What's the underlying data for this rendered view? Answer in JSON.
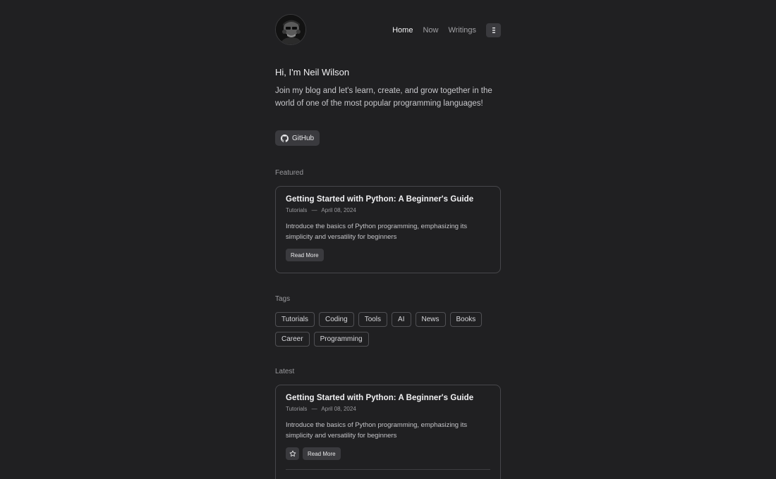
{
  "nav": {
    "items": [
      {
        "label": "Home",
        "active": true
      },
      {
        "label": "Now",
        "active": false
      },
      {
        "label": "Writings",
        "active": false
      }
    ],
    "menu_icon": "menu-icon"
  },
  "intro": {
    "greeting": "Hi, I'm Neil Wilson",
    "text": "Join my blog and let's learn, create, and grow together in the world of one of the most popular programming languages!",
    "github_label": "GitHub"
  },
  "featured": {
    "section_label": "Featured",
    "title": "Getting Started with Python: A Beginner's Guide",
    "category": "Tutorials",
    "separator": "—",
    "date": "April 08, 2024",
    "description": "Introduce the basics of Python programming, emphasizing its simplicity and versatility for beginners",
    "read_more_label": "Read More"
  },
  "tags": {
    "section_label": "Tags",
    "items": [
      "Tutorials",
      "Coding",
      "Tools",
      "AI",
      "News",
      "Books",
      "Career",
      "Programming"
    ]
  },
  "latest": {
    "section_label": "Latest",
    "title": "Getting Started with Python: A Beginner's Guide",
    "category": "Tutorials",
    "separator": "—",
    "date": "April 08, 2024",
    "description": "Introduce the basics of Python programming, emphasizing its simplicity and versatility for beginners",
    "read_more_label": "Read More",
    "star_icon": "star-icon"
  },
  "colors": {
    "background": "#202022",
    "button_bg": "#3a3a3e",
    "border": "#47474b"
  }
}
